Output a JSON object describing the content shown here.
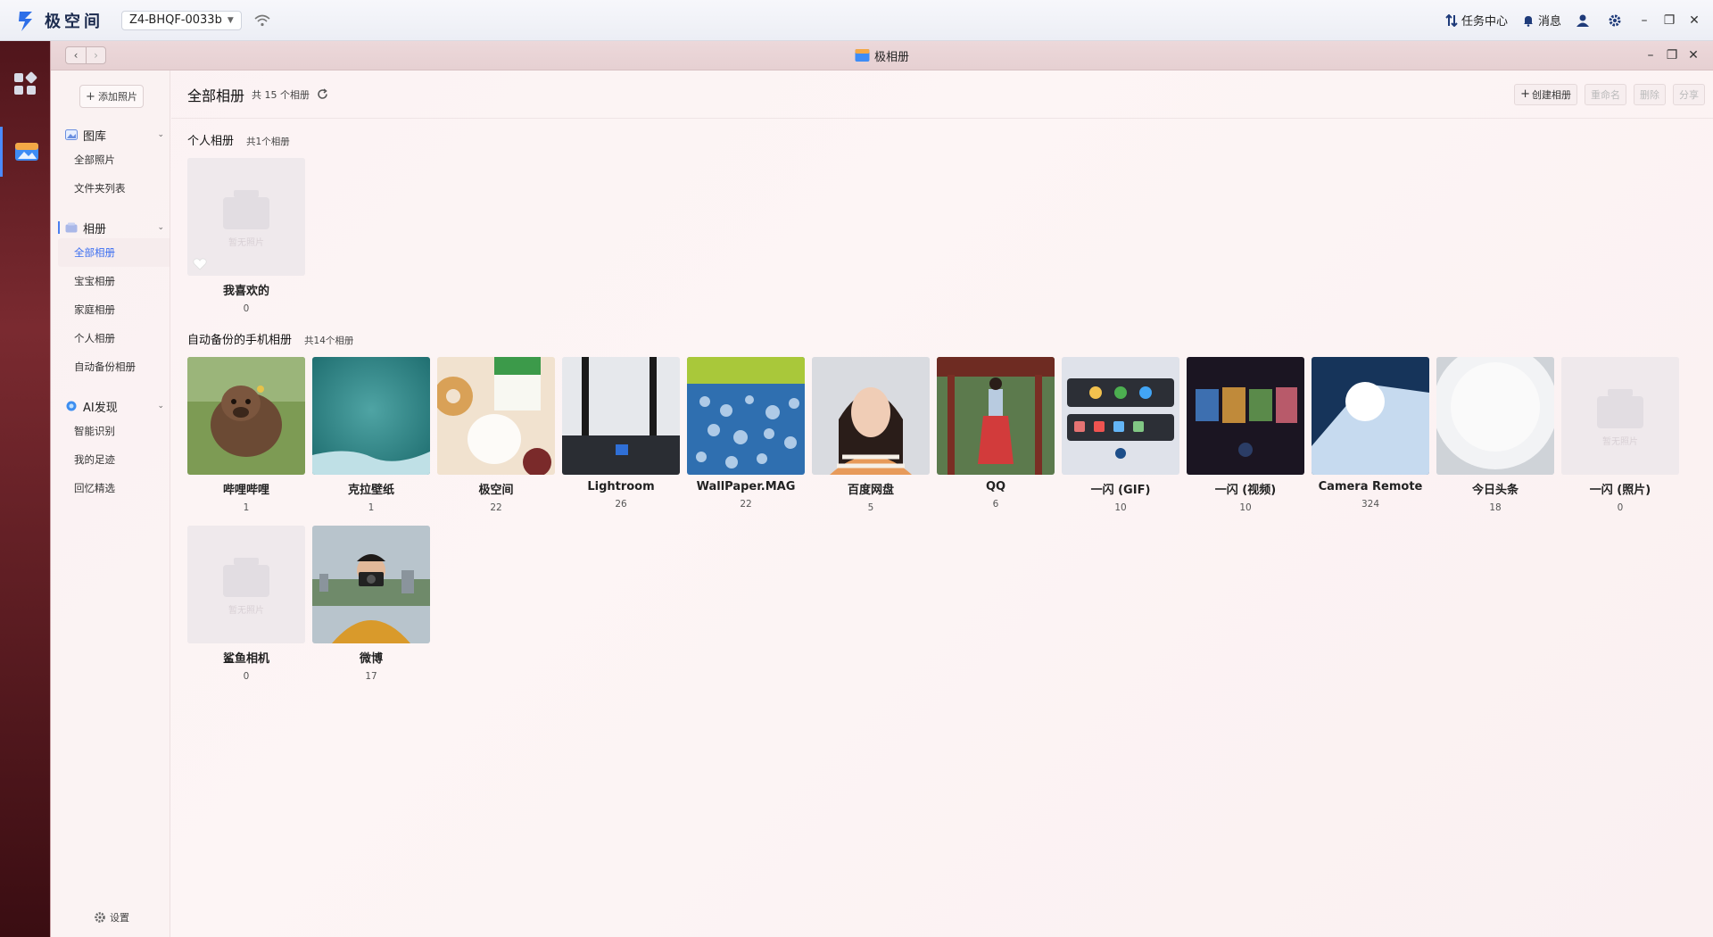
{
  "topbar": {
    "brand": "极空间",
    "device": "Z4-BHQF-0033b",
    "task_center": "任务中心",
    "messages": "消息"
  },
  "window": {
    "title": "极相册"
  },
  "sidebar": {
    "add_photo": "添加照片",
    "sections": [
      {
        "label": "图库",
        "items": [
          "全部照片",
          "文件夹列表"
        ]
      },
      {
        "label": "相册",
        "items": [
          "全部相册",
          "宝宝相册",
          "家庭相册",
          "个人相册",
          "自动备份相册"
        ]
      },
      {
        "label": "AI发现",
        "items": [
          "智能识别",
          "我的足迹",
          "回忆精选"
        ]
      }
    ],
    "active_item": "全部相册",
    "settings": "设置"
  },
  "main": {
    "title": "全部相册",
    "count": "共 15 个相册",
    "toolbar": {
      "create": "创建相册",
      "rename": "重命名",
      "delete": "删除",
      "share": "分享"
    },
    "empty_placeholder": "暂无照片",
    "personal": {
      "title": "个人相册",
      "count": "共1个相册",
      "albums": [
        {
          "name": "我喜欢的",
          "count": "0",
          "thumb": "empty",
          "favorite": true
        }
      ]
    },
    "backup": {
      "title": "自动备份的手机相册",
      "count": "共14个相册",
      "albums": [
        {
          "name": "哔哩哔哩",
          "count": "1",
          "thumb": "calf"
        },
        {
          "name": "克拉壁纸",
          "count": "1",
          "thumb": "teal"
        },
        {
          "name": "极空间",
          "count": "22",
          "thumb": "milk"
        },
        {
          "name": "Lightroom",
          "count": "26",
          "thumb": "router"
        },
        {
          "name": "WallPaper.MAG",
          "count": "22",
          "thumb": "bokeh"
        },
        {
          "name": "百度网盘",
          "count": "5",
          "thumb": "portrait"
        },
        {
          "name": "QQ",
          "count": "6",
          "thumb": "pavilion"
        },
        {
          "name": "一闪 (GIF)",
          "count": "10",
          "thumb": "appgrid"
        },
        {
          "name": "一闪 (视频)",
          "count": "10",
          "thumb": "darkapp"
        },
        {
          "name": "Camera Remote",
          "count": "324",
          "thumb": "light"
        },
        {
          "name": "今日头条",
          "count": "18",
          "thumb": "whiteobj"
        },
        {
          "name": "一闪 (照片)",
          "count": "0",
          "thumb": "empty"
        },
        {
          "name": "鲨鱼相机",
          "count": "0",
          "thumb": "empty"
        },
        {
          "name": "微博",
          "count": "17",
          "thumb": "photographer"
        }
      ]
    }
  }
}
